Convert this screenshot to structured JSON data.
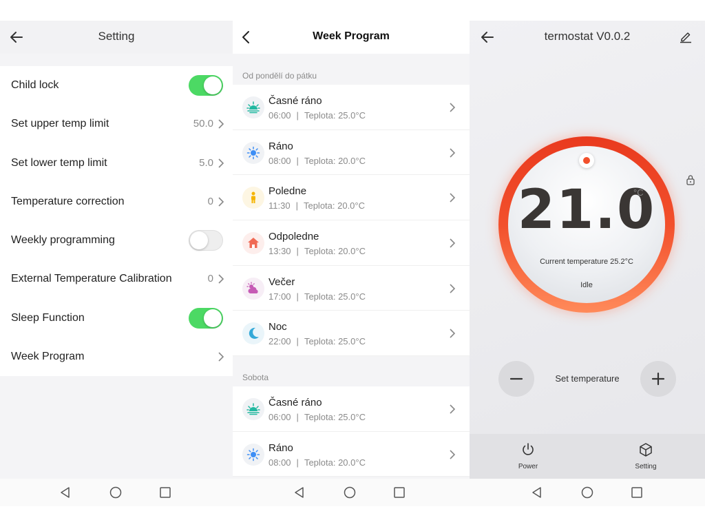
{
  "setting_screen": {
    "title": "Setting",
    "rows": [
      {
        "label": "Child lock",
        "toggle": "on"
      },
      {
        "label": "Set upper temp limit",
        "value": "50.0"
      },
      {
        "label": "Set lower temp limit",
        "value": "5.0"
      },
      {
        "label": "Temperature correction",
        "value": "0"
      },
      {
        "label": "Weekly programming",
        "toggle": "off"
      },
      {
        "label": "External Temperature Calibration",
        "value": "0"
      },
      {
        "label": "Sleep Function",
        "toggle": "on"
      },
      {
        "label": "Week Program"
      }
    ]
  },
  "week_program_screen": {
    "title": "Week Program",
    "section_weekdays": "Od pondělí do pátku",
    "section_saturday": "Sobota",
    "weekday_items": [
      {
        "name": "Časné ráno",
        "time": "06:00",
        "temp": "Teplota: 25.0°C",
        "icon": "sunrise-icon"
      },
      {
        "name": "Ráno",
        "time": "08:00",
        "temp": "Teplota: 20.0°C",
        "icon": "sun-icon"
      },
      {
        "name": "Poledne",
        "time": "11:30",
        "temp": "Teplota: 20.0°C",
        "icon": "person-icon"
      },
      {
        "name": "Odpoledne",
        "time": "13:30",
        "temp": "Teplota: 20.0°C",
        "icon": "home-icon"
      },
      {
        "name": "Večer",
        "time": "17:00",
        "temp": "Teplota: 25.0°C",
        "icon": "cloud-sun-icon"
      },
      {
        "name": "Noc",
        "time": "22:00",
        "temp": "Teplota: 25.0°C",
        "icon": "moon-icon"
      }
    ],
    "saturday_items": [
      {
        "name": "Časné ráno",
        "time": "06:00",
        "temp": "Teplota: 25.0°C",
        "icon": "sunrise-icon"
      },
      {
        "name": "Ráno",
        "time": "08:00",
        "temp": "Teplota: 20.0°C",
        "icon": "sun-icon"
      }
    ],
    "separator": "|"
  },
  "thermostat_screen": {
    "title": "termostat V0.0.2",
    "setpoint": "21.0",
    "unit": "°C",
    "current_temperature": "Current temperature 25.2°C",
    "mode": "Idle",
    "set_temperature_label": "Set temperature",
    "power_label": "Power",
    "setting_label": "Setting"
  },
  "colors": {
    "toggle_on": "#4cd964",
    "dial_accent": "#f2502c",
    "sunrise": "#22b8a0",
    "sun": "#3d8ef5",
    "person": "#f5b400",
    "home": "#f06a55",
    "cloud": "#c65bb5",
    "moon": "#35a9d8"
  }
}
